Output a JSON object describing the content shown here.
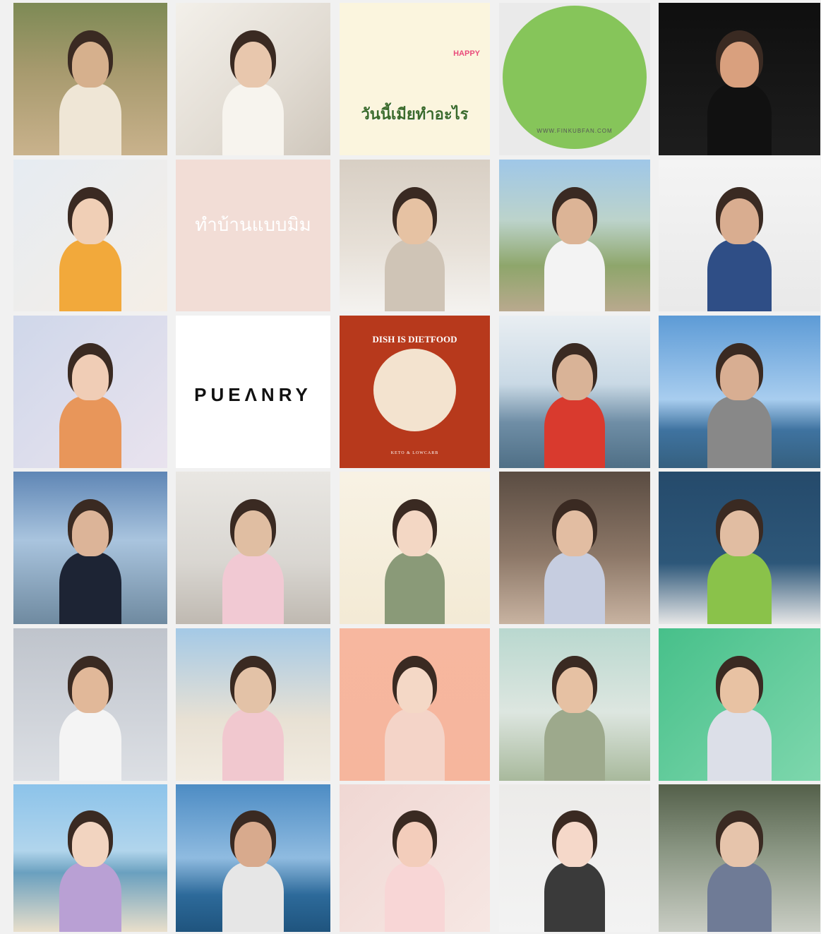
{
  "tiles": [
    {
      "kind": "photo",
      "bg": "linear-gradient(180deg,#7d8a55 0%,#a79a6e 45%,#c9b28c 100%)",
      "skin": "#d6b08d",
      "shirt": "#efe6d6"
    },
    {
      "kind": "photo",
      "bg": "linear-gradient(135deg,#f3f0ea 0%,#e1dbd2 60%,#cfc7bc 100%)",
      "skin": "#e8c7ad",
      "shirt": "#f7f4ee"
    },
    {
      "kind": "text",
      "bg": "#fbf5de",
      "text": "วันนี้เมียทำอะไร",
      "sub": "HAPPY",
      "color": "#3b6b2c",
      "subcolor": "#e94b7b"
    },
    {
      "kind": "text",
      "bg": "#eaeaea",
      "circle": "#86c55a",
      "text": "WWW.FINKUBFAN.COM",
      "color": "#555555"
    },
    {
      "kind": "photo",
      "bg": "linear-gradient(180deg,#0f0f0f 0%,#1d1d1d 100%)",
      "skin": "#d9a07e",
      "shirt": "#111111"
    },
    {
      "kind": "photo",
      "bg": "linear-gradient(135deg,#e6ecf2 0%,#f5eee6 100%)",
      "skin": "#f0cfb6",
      "shirt": "#f2a93b"
    },
    {
      "kind": "text",
      "bg": "#f2ddd6",
      "text": "ทำบ้านแบบมิม",
      "color": "#ffffff"
    },
    {
      "kind": "photo",
      "bg": "linear-gradient(180deg,#d8cfc4 0%,#e6dfd6 55%,#f4f2ef 100%)",
      "skin": "#e6c2a3",
      "shirt": "#cfc4b6"
    },
    {
      "kind": "photo",
      "bg": "linear-gradient(180deg,#9fc7e8 0%,#bcd3cb 40%,#8ea66b 70%,#b9a98e 100%)",
      "skin": "#dcb496",
      "shirt": "#f3f3f3"
    },
    {
      "kind": "photo",
      "bg": "linear-gradient(180deg,#f4f4f4 0%,#e9e9e9 100%)",
      "skin": "#d9ad90",
      "shirt": "#2f4e86"
    },
    {
      "kind": "photo",
      "bg": "linear-gradient(135deg,#cfd7ea 0%,#e9e3ee 100%)",
      "skin": "#f0cdb6",
      "shirt": "#e8965a"
    },
    {
      "kind": "text",
      "bg": "#ffffff",
      "text": "PUEΛNRY",
      "color": "#111111"
    },
    {
      "kind": "text",
      "bg": "#b7391c",
      "text": "DISH IS DIETFOOD",
      "sub": "KETO & LOWCARB",
      "color": "#ffffff",
      "circle": "#f3e3cf"
    },
    {
      "kind": "photo",
      "bg": "linear-gradient(180deg,#e9eef2 0%,#c9d9e5 45%,#6f8ea6 70%,#4f6f86 100%)",
      "skin": "#d9b397",
      "shirt": "#d93a2e"
    },
    {
      "kind": "photo",
      "bg": "linear-gradient(180deg,#5d9bd6 0%,#a8cdef 55%,#3f73a0 75%,#35607f 100%)",
      "skin": "#d8ae92",
      "shirt": "#888888"
    },
    {
      "kind": "photo",
      "bg": "linear-gradient(180deg,#5f86b5 0%,#a9c4de 45%,#6f8aa0 100%)",
      "skin": "#dcb498",
      "shirt": "#1d2434"
    },
    {
      "kind": "photo",
      "bg": "linear-gradient(180deg,#e9e7e3 0%,#d9d6d1 60%,#bfb9b1 100%)",
      "skin": "#e0bea2",
      "shirt": "#f1c9d3"
    },
    {
      "kind": "photo",
      "bg": "linear-gradient(180deg,#f8f2e4 0%,#f3ead5 100%)",
      "skin": "#f3d7c4",
      "shirt": "#8a9a78"
    },
    {
      "kind": "photo",
      "bg": "linear-gradient(180deg,#5a4c42 0%,#8c7767 55%,#c8b3a1 100%)",
      "skin": "#e2bda2",
      "shirt": "#c6cde0"
    },
    {
      "kind": "photo",
      "bg": "linear-gradient(180deg,#254a6b 0%,#2d5779 60%,#e7e7e7 100%)",
      "skin": "#e1bda2",
      "shirt": "#8ac24a"
    },
    {
      "kind": "photo",
      "bg": "linear-gradient(180deg,#bfc4cc 0%,#dcdfe4 100%)",
      "skin": "#e1b899",
      "shirt": "#f4f4f4"
    },
    {
      "kind": "photo",
      "bg": "linear-gradient(180deg,#a4c9e6 0%,#e8e1d4 60%,#f1ebe0 100%)",
      "skin": "#e3c2a7",
      "shirt": "#f1c8cf"
    },
    {
      "kind": "photo",
      "bg": "linear-gradient(180deg,#f7b79f 0%,#f6b69d 100%)",
      "skin": "#f4d8c6",
      "shirt": "#f4d4c8"
    },
    {
      "kind": "photo",
      "bg": "linear-gradient(180deg,#b9d8cf 0%,#dde6e0 55%,#a8b99c 100%)",
      "skin": "#e6c1a3",
      "shirt": "#9da98c"
    },
    {
      "kind": "photo",
      "bg": "linear-gradient(135deg,#47c08a 0%,#7ed7ad 100%)",
      "skin": "#e8c2a3",
      "shirt": "#dcdfe8"
    },
    {
      "kind": "photo",
      "bg": "linear-gradient(180deg,#8cc3ea 0%,#b1d5ec 45%,#6aa0bf 60%,#e9dfcb 100%)",
      "skin": "#f2d4c0",
      "shirt": "#b9a0d4"
    },
    {
      "kind": "photo",
      "bg": "linear-gradient(180deg,#4d8cc4 0%,#8fbbe0 50%,#2d6a9a 75%,#1f547e 100%)",
      "skin": "#d8aa8d",
      "shirt": "#e6e6e6"
    },
    {
      "kind": "photo",
      "bg": "linear-gradient(135deg,#f0d7d3 0%,#f6e7e3 100%)",
      "skin": "#f3cdbb",
      "shirt": "#f8d6d6"
    },
    {
      "kind": "photo",
      "bg": "linear-gradient(180deg,#ecebe9 0%,#f3f3f3 100%)",
      "skin": "#f5d8c9",
      "shirt": "#3a3a3a"
    },
    {
      "kind": "photo",
      "bg": "linear-gradient(180deg,#54604a 0%,#8a9683 45%,#c9cdc4 100%)",
      "skin": "#e6c4ab",
      "shirt": "#6f7b96"
    }
  ]
}
